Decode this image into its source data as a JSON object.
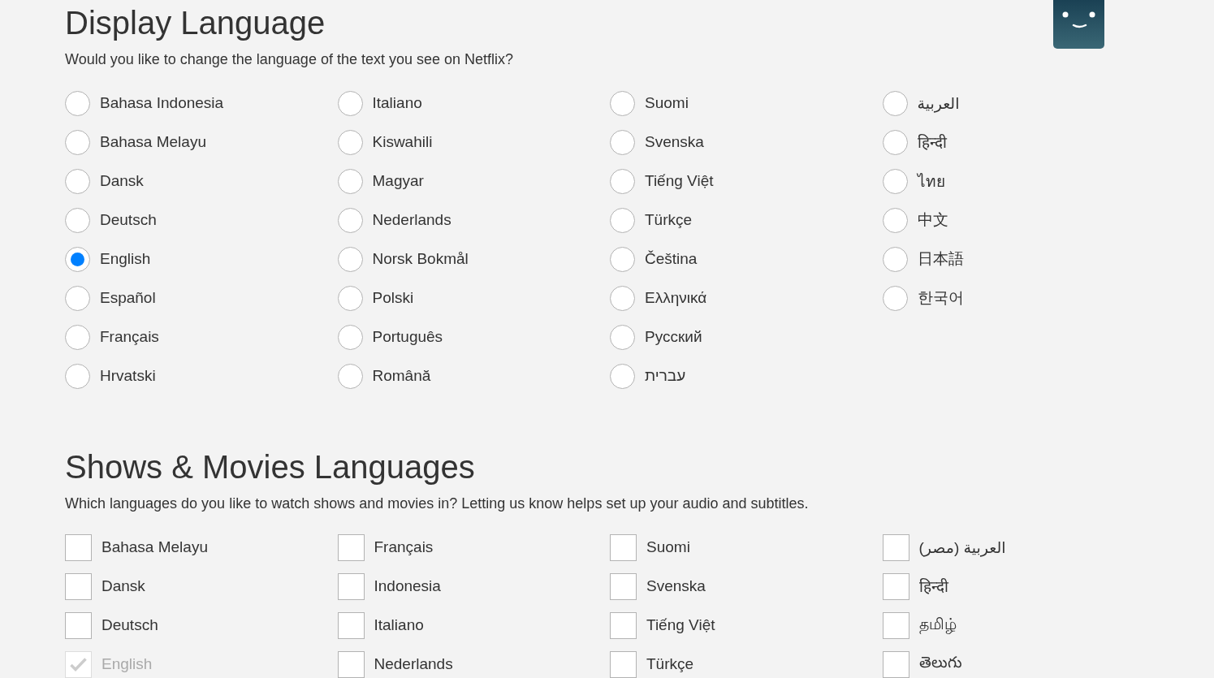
{
  "profile": {
    "avatar": true
  },
  "display_language": {
    "title": "Display Language",
    "subtitle": "Would you like to change the language of the text you see on Netflix?",
    "options": [
      {
        "label": "Bahasa Indonesia",
        "selected": false
      },
      {
        "label": "Bahasa Melayu",
        "selected": false
      },
      {
        "label": "Dansk",
        "selected": false
      },
      {
        "label": "Deutsch",
        "selected": false
      },
      {
        "label": "English",
        "selected": true
      },
      {
        "label": "Español",
        "selected": false
      },
      {
        "label": "Français",
        "selected": false
      },
      {
        "label": "Hrvatski",
        "selected": false
      },
      {
        "label": "Italiano",
        "selected": false
      },
      {
        "label": "Kiswahili",
        "selected": false
      },
      {
        "label": "Magyar",
        "selected": false
      },
      {
        "label": "Nederlands",
        "selected": false
      },
      {
        "label": "Norsk Bokmål",
        "selected": false
      },
      {
        "label": "Polski",
        "selected": false
      },
      {
        "label": "Português",
        "selected": false
      },
      {
        "label": "Română",
        "selected": false
      },
      {
        "label": "Suomi",
        "selected": false
      },
      {
        "label": "Svenska",
        "selected": false
      },
      {
        "label": "Tiếng Việt",
        "selected": false
      },
      {
        "label": "Türkçe",
        "selected": false
      },
      {
        "label": "Čeština",
        "selected": false
      },
      {
        "label": "Ελληνικά",
        "selected": false
      },
      {
        "label": "Русский",
        "selected": false
      },
      {
        "label": "עברית",
        "selected": false
      },
      {
        "label": "العربية",
        "selected": false
      },
      {
        "label": "हिन्दी",
        "selected": false
      },
      {
        "label": "ไทย",
        "selected": false
      },
      {
        "label": "中文",
        "selected": false
      },
      {
        "label": "日本語",
        "selected": false
      },
      {
        "label": "한국어",
        "selected": false
      }
    ]
  },
  "shows_movies_languages": {
    "title": "Shows & Movies Languages",
    "subtitle": "Which languages do you like to watch shows and movies in? Letting us know helps set up your audio and subtitles.",
    "options": [
      {
        "label": "Bahasa Melayu",
        "checked": false,
        "disabled": false
      },
      {
        "label": "Dansk",
        "checked": false,
        "disabled": false
      },
      {
        "label": "Deutsch",
        "checked": false,
        "disabled": false
      },
      {
        "label": "English",
        "checked": true,
        "disabled": true
      },
      {
        "label": "Français",
        "checked": false,
        "disabled": false
      },
      {
        "label": "Indonesia",
        "checked": false,
        "disabled": false
      },
      {
        "label": "Italiano",
        "checked": false,
        "disabled": false
      },
      {
        "label": "Nederlands",
        "checked": false,
        "disabled": false
      },
      {
        "label": "Suomi",
        "checked": false,
        "disabled": false
      },
      {
        "label": "Svenska",
        "checked": false,
        "disabled": false
      },
      {
        "label": "Tiếng Việt",
        "checked": false,
        "disabled": false
      },
      {
        "label": "Türkçe",
        "checked": false,
        "disabled": false
      },
      {
        "label": "العربية (مصر)",
        "checked": false,
        "disabled": false
      },
      {
        "label": "हिन्दी",
        "checked": false,
        "disabled": false
      },
      {
        "label": "தமிழ்",
        "checked": false,
        "disabled": false
      },
      {
        "label": "తెలుగు",
        "checked": false,
        "disabled": false
      }
    ]
  }
}
